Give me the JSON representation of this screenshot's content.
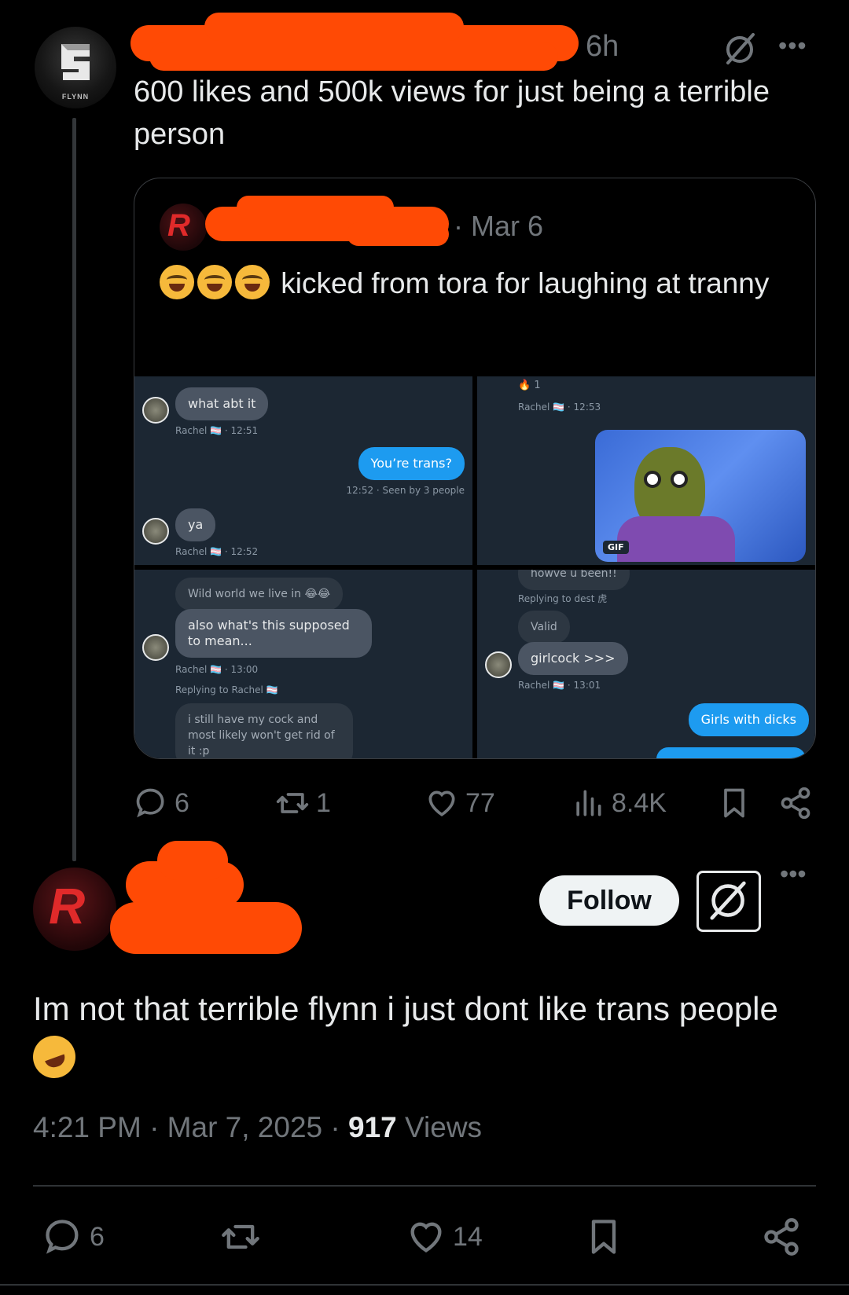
{
  "parent_tweet": {
    "avatar_brand": "FLYNN",
    "time": "6h",
    "text": "600 likes and 500k views for just being a terrible person",
    "quote": {
      "date": "· Mar 6",
      "text": "kicked from tora for laughing at tranny",
      "screenshots": {
        "c1": {
          "b1": "what abt it",
          "m1": "Rachel 🏳️‍⚧️ · 12:51",
          "b2": "You’re trans?",
          "m2": "12:52 · Seen by 3 people",
          "b3": "ya",
          "m3": "Rachel 🏳️‍⚧️ · 12:52"
        },
        "c2": {
          "reaction": "🔥 1",
          "m1": "Rachel 🏳️‍⚧️ · 12:53",
          "gif": "GIF"
        },
        "c3": {
          "b1": "Wild world we live in 😂😂",
          "b2": "also what's this supposed to mean...",
          "m1": "Rachel 🏳️‍⚧️ · 13:00",
          "reply": "Replying to Rachel 🏳️‍⚧️",
          "b3": "i still have my cock and most likely won't get rid of it :p"
        },
        "c4": {
          "top": "howve u been!!",
          "reply": "Replying to dest 虎",
          "b1": "Valid",
          "b2": "girlcock >>>",
          "m1": "Rachel 🏳️‍⚧️ · 13:01",
          "b3": "Girls with dicks"
        }
      }
    },
    "actions": {
      "replies": "6",
      "reposts": "1",
      "likes": "77",
      "views": "8.4K"
    }
  },
  "main_tweet": {
    "follow_label": "Follow",
    "text": "Im not that terrible flynn i just dont like trans people",
    "time": "4:21 PM · Mar 7, 2025 · ",
    "views_count": "917",
    "views_label": " Views",
    "actions": {
      "replies": "6",
      "likes": "14"
    }
  },
  "colors": {
    "redaction": "#ff4a05",
    "muted": "#71767b",
    "text": "#e7e9ea",
    "blue": "#1d9bf0"
  }
}
